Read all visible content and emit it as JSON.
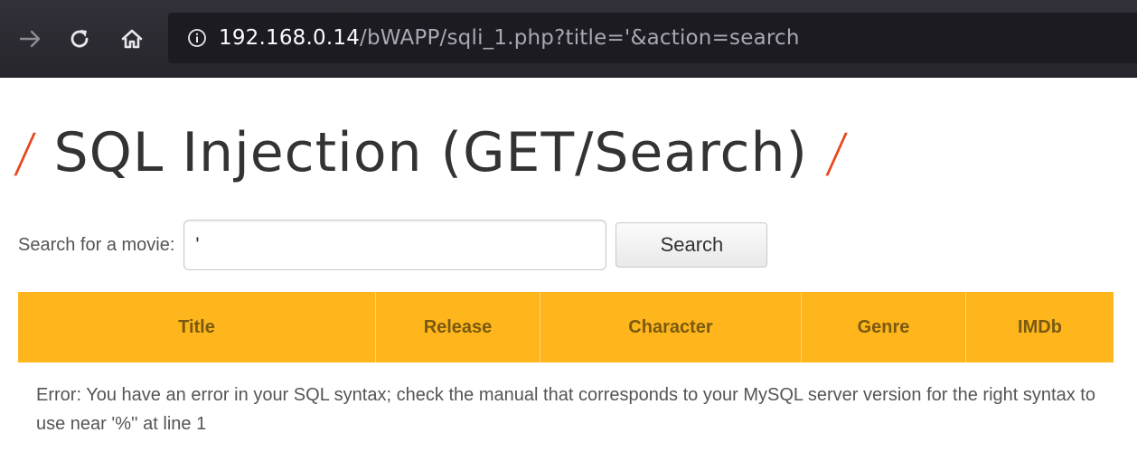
{
  "browser": {
    "url_host": "192.168.0.14",
    "url_path": "/bWAPP/sqli_1.php?title='&action=search",
    "icons": {
      "back": "arrow-right-icon",
      "reload": "reload-icon",
      "home": "home-icon",
      "info": "info-icon"
    }
  },
  "page": {
    "slash_left": "/",
    "title": "SQL Injection (GET/Search)",
    "slash_right": "/",
    "accent_color": "#e8461f"
  },
  "search": {
    "label": "Search for a movie:",
    "value": "'",
    "button_label": "Search"
  },
  "table": {
    "header_color": "#ffb61c",
    "columns": [
      "Title",
      "Release",
      "Character",
      "Genre",
      "IMDb"
    ],
    "error_message": "Error: You have an error in your SQL syntax; check the manual that corresponds to your MySQL server version for the right syntax to use near '%'' at line 1"
  }
}
